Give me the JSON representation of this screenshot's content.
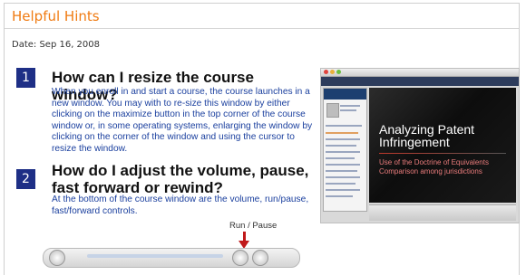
{
  "header": {
    "title": "Helpful Hints"
  },
  "meta": {
    "date": "Date: Sep 16, 2008"
  },
  "hints": [
    {
      "number": "1",
      "question": "How can I resize the course window?",
      "answer": "When you enroll in and start a course, the course launches in a new window. You may with to re-size this window by either clicking on the maximize button in the top corner of the course window or, in some operating systems, enlarging the window by clicking on the corner of the window and using the cursor to resize the window."
    },
    {
      "number": "2",
      "question": "How do I adjust the volume, pause, fast forward or rewind?",
      "answer": "At the bottom of the course window are the volume, run/pause, fast/forward controls."
    }
  ],
  "screenshot": {
    "slide_title": "Analyzing Patent Infringement",
    "slide_subtitle": "Use of the Doctrine of Equivalents Comparison among jurisdictions"
  },
  "controls": {
    "run_pause_label": "Run / Pause"
  },
  "colors": {
    "accent": "#f07b12",
    "number_badge": "#1e2f86",
    "answer_text": "#1a3f9e",
    "arrow": "#c0191b"
  }
}
